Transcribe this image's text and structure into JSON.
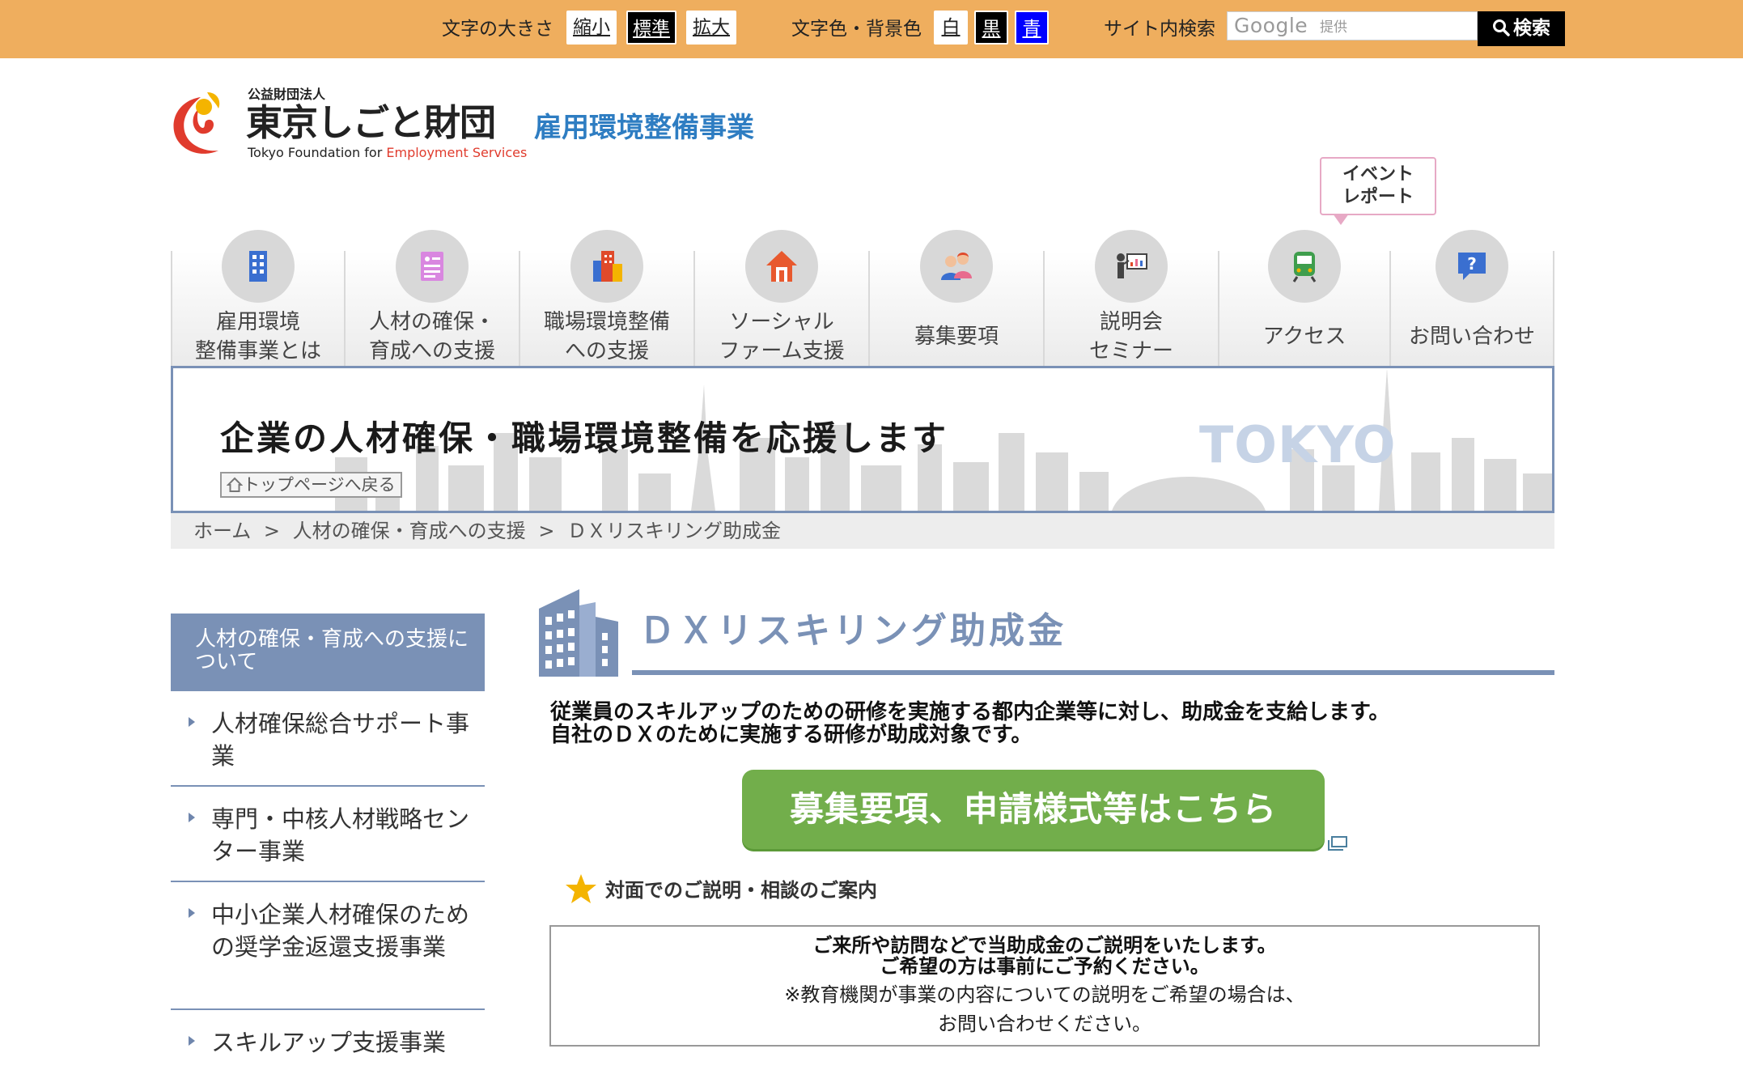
{
  "topbar": {
    "font_size_label": "文字の大きさ",
    "font_size_buttons": [
      "縮小",
      "標準",
      "拡大"
    ],
    "color_label": "文字色・背景色",
    "color_buttons": [
      "白",
      "黒",
      "青"
    ],
    "search_label": "サイト内検索",
    "search_placeholder_logo": "Google",
    "search_placeholder_sub": "提供",
    "search_button": "検索"
  },
  "header": {
    "logo_small": "公益財団法人",
    "logo_main": "東京しごと財団",
    "logo_en_prefix": "Tokyo Foundation for ",
    "logo_en_accent": "Employment Services",
    "site_title": "雇用環境整備事業"
  },
  "nav": {
    "event_badge": "イベント\nレポート",
    "items": [
      {
        "label": "雇用環境\n整備事業とは",
        "icon": "building-icon"
      },
      {
        "label": "人材の確保・\n育成への支援",
        "icon": "id-card-icon"
      },
      {
        "label": "職場環境整備\nへの支援",
        "icon": "office-buildings-icon"
      },
      {
        "label": "ソーシャル\nファーム支援",
        "icon": "house-icon"
      },
      {
        "label": "募集要項",
        "icon": "people-icon"
      },
      {
        "label": "説明会\nセミナー",
        "icon": "presentation-icon"
      },
      {
        "label": "アクセス",
        "icon": "train-icon"
      },
      {
        "label": "お問い合わせ",
        "icon": "question-bubble-icon"
      }
    ]
  },
  "banner": {
    "text": "企業の人材確保・職場環境整備を応援します",
    "tokyo": "TOKYO",
    "back_top": "トップページへ戻る"
  },
  "breadcrumb": [
    "ホーム",
    ">",
    "人材の確保・育成への支援",
    ">",
    "ＤＸリスキリング助成金"
  ],
  "sidebar": {
    "heading": "人材の確保・育成への支援について",
    "items": [
      "人材確保総合サポート事業",
      "専門・中核人材戦略センター事業",
      "中小企業人材確保のための奨学金返還支援事業",
      "スキルアップ支援事業"
    ]
  },
  "main": {
    "title": "ＤＸリスキリング助成金",
    "intro_line1": "従業員のスキルアップのための研修を実施する都内企業等に対し、助成金を支給します。",
    "intro_line2": "自社のＤＸのために実施する研修が助成対象です。",
    "apply_button": "募集要項、申請様式等はこちら",
    "star_heading": "対面でのご説明・相談のご案内",
    "info_line1": "ご来所や訪問などで当助成金のご説明をいたします。",
    "info_line2": "ご希望の方は事前にご予約ください。",
    "info_line3": "※教育機関が事業の内容についての説明をご希望の場合は、",
    "info_line4": "お問い合わせください。"
  },
  "colors": {
    "topbar_bg": "#EFAE5E",
    "accent_blue": "#7A91B6",
    "site_title_blue": "#2E7DC2",
    "apply_green": "#72AE4B",
    "logo_red": "#E03B2D"
  }
}
